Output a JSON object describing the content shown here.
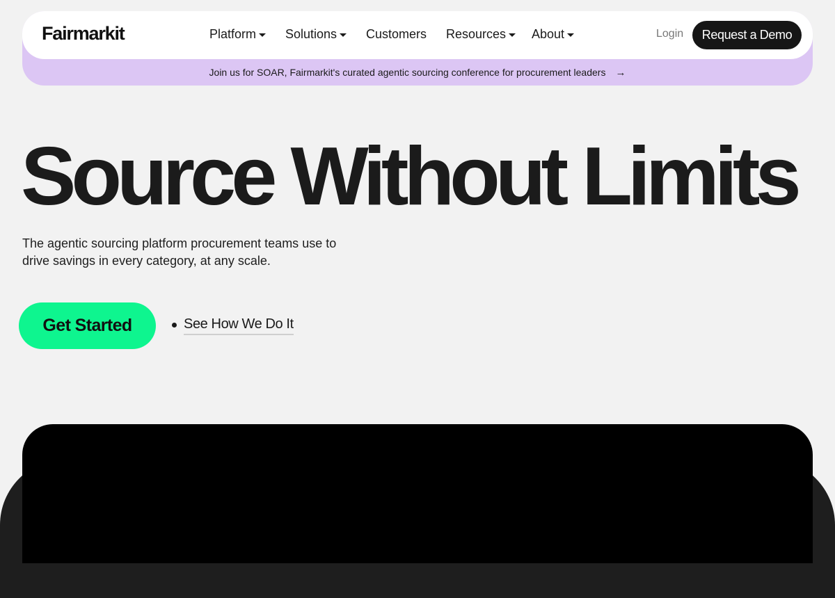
{
  "header": {
    "logo": "Fairmarkit",
    "nav": {
      "platform": "Platform",
      "solutions": "Solutions",
      "customers": "Customers",
      "resources": "Resources",
      "about": "About"
    },
    "login_label": "Login",
    "demo_label": "Request a Demo"
  },
  "announcement": {
    "text": "Join us for SOAR, Fairmarkit's curated agentic sourcing conference for procurement leaders",
    "arrow": "→"
  },
  "hero": {
    "title": "Source Without Limits",
    "subtitle": "The agentic sourcing platform procurement teams use to drive savings in every category, at any scale.",
    "cta_label": "Get Started",
    "secondary_label": "See How We Do It"
  },
  "colors": {
    "background": "#f2f2f2",
    "announcement_bg": "#dcc6f4",
    "cta_green": "#0ef58f",
    "demo_button_bg": "#161616",
    "media_frame": "#000000"
  },
  "icons": {
    "dropdown": "caret-down-icon",
    "announcement": "arrow-right-icon",
    "secondary": "bullet-dot-icon"
  }
}
